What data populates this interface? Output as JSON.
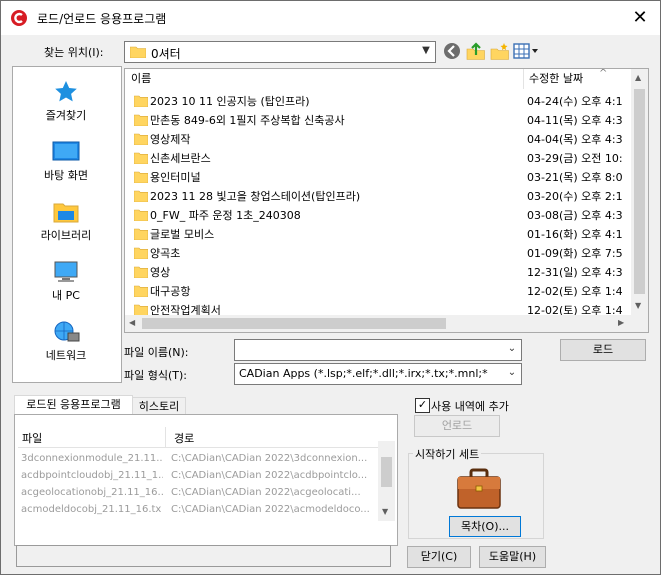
{
  "window": {
    "title": "로드/언로드 응용프로그램",
    "close_glyph": "✕"
  },
  "lookin": {
    "label": "찾는 위치(I):",
    "value": "0셔터"
  },
  "toolbar": {
    "icons": [
      "back-icon",
      "up-folder-icon",
      "new-folder-icon",
      "view-menu-icon"
    ]
  },
  "places": [
    {
      "label": "즐겨찾기",
      "icon": "star-icon"
    },
    {
      "label": "바탕 화면",
      "icon": "desktop-icon"
    },
    {
      "label": "라이브러리",
      "icon": "library-icon"
    },
    {
      "label": "내 PC",
      "icon": "pc-icon"
    },
    {
      "label": "네트워크",
      "icon": "network-icon"
    }
  ],
  "file_list": {
    "col_name": "이름",
    "col_date": "수정한 날짜",
    "sort_glyph": "^",
    "rows": [
      {
        "name": "2023 10 11 인공지능 (탑인프라)",
        "date": "04-24(수) 오후 4:1"
      },
      {
        "name": "만촌동 849-6외 1필지 주상복합 신축공사",
        "date": "04-11(목) 오후 4:3"
      },
      {
        "name": "영상제작",
        "date": "04-04(목) 오후 4:3"
      },
      {
        "name": "신촌세브란스",
        "date": "03-29(금) 오전 10:"
      },
      {
        "name": "용인터미널",
        "date": "03-21(목) 오후 8:0"
      },
      {
        "name": "2023 11 28 빛고을 창업스테이션(탑인프라)",
        "date": "03-20(수) 오후 2:1"
      },
      {
        "name": "0_FW_ 파주 운정 1초_240308",
        "date": "03-08(금) 오후 4:3"
      },
      {
        "name": "글로벌 모비스",
        "date": "01-16(화) 오후 4:1"
      },
      {
        "name": "양곡초",
        "date": "01-09(화) 오후 7:5"
      },
      {
        "name": "영상",
        "date": "12-31(일) 오후 4:3"
      },
      {
        "name": "대구공항",
        "date": "12-02(토) 오후 1:4"
      },
      {
        "name": "안전작업계획서",
        "date": "12-02(토) 오후 1:4"
      }
    ]
  },
  "filename": {
    "label": "파일 이름(N):",
    "value": ""
  },
  "filetype": {
    "label": "파일 형식(T):",
    "value": "CADian Apps (*.lsp;*.elf;*.dll;*.irx;*.tx;*.mnl;*"
  },
  "load_button": "로드",
  "tabs": [
    "로드된 응용프로그램",
    "히스토리"
  ],
  "loaded_table": {
    "col_file": "파일",
    "col_path": "경로",
    "rows": [
      {
        "file": "3dconnexionmodule_21.11...",
        "path": "C:\\CADian\\CADian 2022\\3dconnexion..."
      },
      {
        "file": "acdbpointcloudobj_21.11_1...",
        "path": "C:\\CADian\\CADian 2022\\acdbpointclo..."
      },
      {
        "file": "acgeolocationobj_21.11_16...",
        "path": "C:\\CADian\\CADian 2022\\acgeolocati..."
      },
      {
        "file": "acmodeldocobj_21.11_16.tx",
        "path": "C:\\CADian\\CADian 2022\\acmodeldoco..."
      }
    ]
  },
  "add_history": {
    "label": "사용 내역에 추가",
    "checked": true
  },
  "unload_button": "언로드",
  "startup": {
    "title": "시작하기 세트",
    "contents_button": "목차(O)..."
  },
  "close_button": "닫기(C)",
  "help_button": "도움말(H)",
  "colors": {
    "accent": "#0078d7",
    "folder": "#ffd560",
    "brand_red": "#d71c24"
  }
}
